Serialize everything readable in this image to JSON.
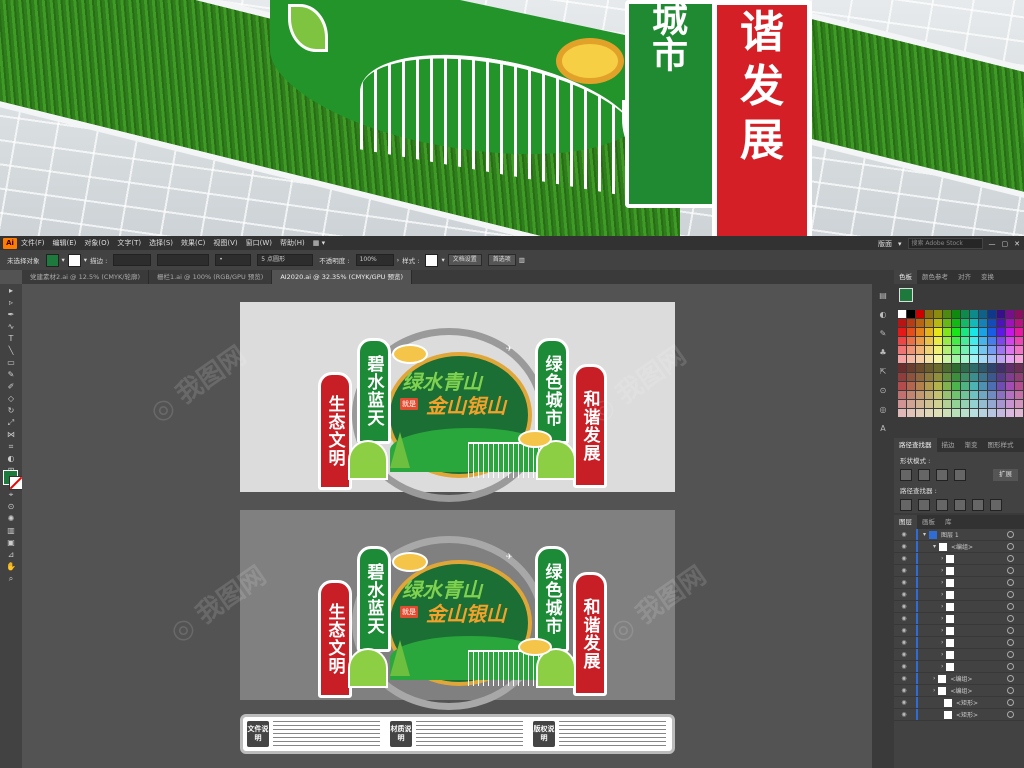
{
  "photo": {
    "red_panel_text": "谐发展",
    "green_panel_text": "城市"
  },
  "app": {
    "logo": "Ai",
    "menu": [
      "文件(F)",
      "编辑(E)",
      "对象(O)",
      "文字(T)",
      "选择(S)",
      "效果(C)",
      "视图(V)",
      "窗口(W)",
      "帮助(H)"
    ],
    "workspace": "版面",
    "search_placeholder": "搜索 Adobe Stock"
  },
  "control_bar": {
    "selection": "未选择对象",
    "stroke_label": "描边 :",
    "brush_label": "5 点圆形",
    "opacity_label": "不透明度 :",
    "opacity_value": "100%",
    "style_label": "样式 :",
    "doc_setup": "文档设置",
    "preferences": "首选项"
  },
  "tabs": [
    {
      "label": "党建素材2.ai @ 12.5% (CMYK/轮廓)",
      "active": false
    },
    {
      "label": "栅栏1.ai @ 100% (RGB/GPU 预览)",
      "active": false
    },
    {
      "label": "AI2020.ai @ 32.35% (CMYK/GPU 预览)",
      "active": true
    }
  ],
  "design": {
    "pillar1": "生态文明",
    "pillar2": "碧水蓝天",
    "pillar3": "绿色城市",
    "pillar4": "和谐发展",
    "title_top": "绿水青山",
    "title_bottom": "金山银山",
    "badge1": "就是"
  },
  "info": {
    "box1": "文件说明",
    "box2": "材质说明",
    "box3": "版权说明"
  },
  "panels": {
    "tabs_top": [
      "色板",
      "颜色参考",
      "对齐",
      "变换"
    ],
    "tabs_mid": [
      "路径查找器",
      "描边",
      "渐变",
      "图形样式"
    ],
    "shape_mode_label": "形状模式 :",
    "pathfinder_label": "路径查找器 :",
    "expand_label": "扩展",
    "tabs_layers": [
      "图层",
      "画板",
      "库"
    ],
    "layer_name": "图层 1",
    "group_label": "<编组>",
    "rect_label": "<矩形>"
  },
  "colors": {
    "accent_green": "#1e7a3c",
    "accent_red": "#c81e25",
    "accent_orange": "#f2a12a",
    "ui_dark": "#323232"
  }
}
